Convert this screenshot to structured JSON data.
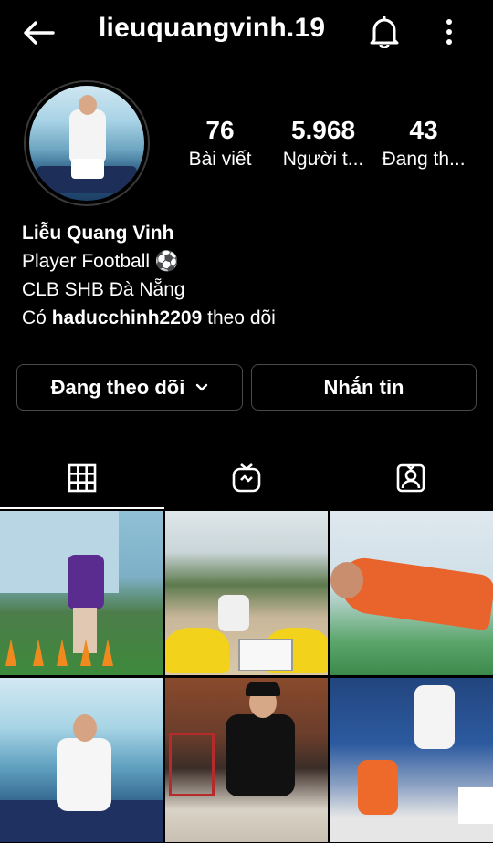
{
  "header": {
    "username": "lieuquangvinh.19",
    "back_icon": "arrow-left-icon",
    "bell_icon": "bell-icon",
    "more_icon": "more-vertical-icon"
  },
  "profile": {
    "stats": [
      {
        "value": "76",
        "label": "Bài viết"
      },
      {
        "value": "5.968",
        "label": "Người t..."
      },
      {
        "value": "43",
        "label": "Đang th..."
      }
    ],
    "name": "Liễu Quang Vinh",
    "bio_lines": [
      "Player Football ⚽",
      "CLB SHB Đà Nẵng"
    ],
    "followed_by_prefix": "Có",
    "followed_by_user": "haducchinh2209",
    "followed_by_suffix": "theo dõi"
  },
  "actions": {
    "following_label": "Đang theo dõi",
    "message_label": "Nhắn tin"
  },
  "tabs": {
    "items": [
      "grid-icon",
      "igtv-icon",
      "tagged-icon"
    ],
    "active": "grid-icon"
  },
  "colors": {
    "background": "#000000",
    "text": "#ffffff",
    "border": "#4a4a4a"
  }
}
